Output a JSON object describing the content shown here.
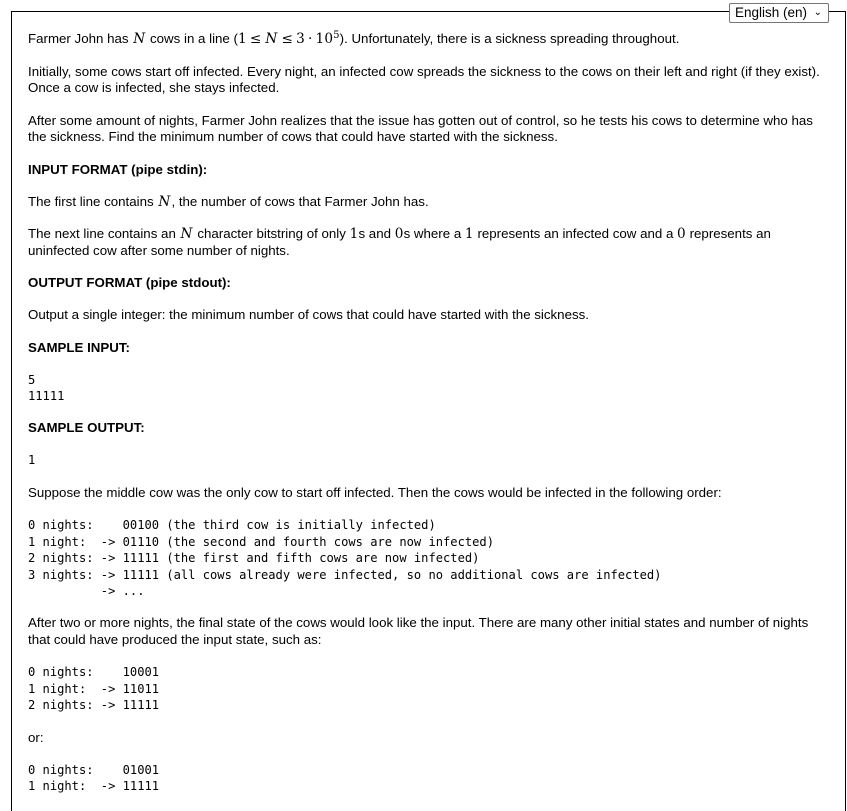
{
  "language_selector": {
    "name": "language-select",
    "selected": "English (en)",
    "options": [
      "English (en)"
    ],
    "chevron": "chevron-down-icon"
  },
  "problem": {
    "intro": {
      "p1_before_math": "Farmer John has ",
      "p1_math_n": "N",
      "p1_mid": " cows in a line (",
      "p1_math_range": "1 ≤ N ≤ 3 · 10",
      "p1_math_exp": "5",
      "p1_after_math": "). Unfortunately, there is a sickness spreading throughout.",
      "p2": "Initially, some cows start off infected. Every night, an infected cow spreads the sickness to the cows on their left and right (if they exist). Once a cow is infected, she stays infected.",
      "p3": "After some amount of nights, Farmer John realizes that the issue has gotten out of control, so he tests his cows to determine who has the sickness. Find the minimum number of cows that could have started with the sickness."
    },
    "input_format": {
      "heading": "INPUT FORMAT (pipe stdin):",
      "line1_a": "The first line contains ",
      "line1_math": "N",
      "line1_b": ", the number of cows that Farmer John has.",
      "line2_a": "The next line contains an ",
      "line2_math_n": "N",
      "line2_b": " character bitstring of only ",
      "line2_math_1": "1",
      "line2_c": "s and ",
      "line2_math_0": "0",
      "line2_d": "s where a ",
      "line2_math_1b": "1",
      "line2_e": " represents an infected cow and a ",
      "line2_math_0b": "0",
      "line2_f": " represents an uninfected cow after some number of nights."
    },
    "output_format": {
      "heading": "OUTPUT FORMAT (pipe stdout):",
      "text": "Output a single integer: the minimum number of cows that could have started with the sickness."
    },
    "sample_input": {
      "heading": "SAMPLE INPUT:",
      "code": "5\n11111"
    },
    "sample_output": {
      "heading": "SAMPLE OUTPUT:",
      "code": "1"
    },
    "explanation": {
      "p1": "Suppose the middle cow was the only cow to start off infected. Then the cows would be infected in the following order:",
      "trace1": "0 nights:    00100 (the third cow is initially infected)\n1 night:  -> 01110 (the second and fourth cows are now infected)\n2 nights: -> 11111 (the first and fifth cows are now infected)\n3 nights: -> 11111 (all cows already were infected, so no additional cows are infected)\n          -> ...",
      "p2": "After two or more nights, the final state of the cows would look like the input. There are many other initial states and number of nights that could have produced the input state, such as:",
      "trace2": "0 nights:    10001\n1 night:  -> 11011\n2 nights: -> 11111",
      "p3": "or:",
      "trace3": "0 nights:    01001\n1 night:  -> 11111"
    }
  }
}
